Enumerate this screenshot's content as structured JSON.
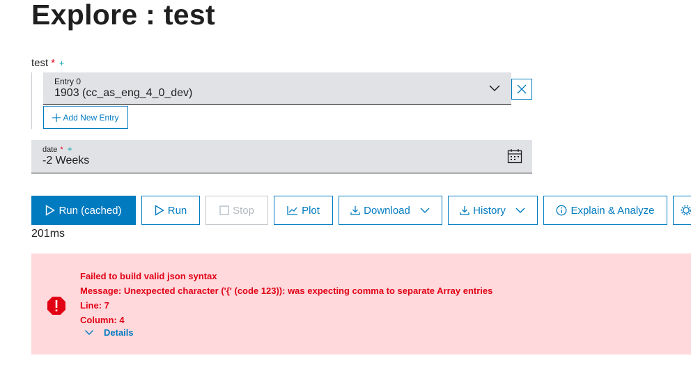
{
  "page": {
    "title": "Explore : test"
  },
  "test_field": {
    "label": "test",
    "required_mark": "*",
    "add_mark": "+",
    "entry": {
      "label": "Entry 0",
      "value": "1903 (cc_as_eng_4_0_dev)"
    },
    "add_entry_label": "Add New Entry"
  },
  "date_field": {
    "label": "date",
    "required_mark": "*",
    "add_mark": "+",
    "value": "-2 Weeks"
  },
  "toolbar": {
    "run_cached": "Run (cached)",
    "run": "Run",
    "stop": "Stop",
    "plot": "Plot",
    "download": "Download",
    "history": "History",
    "explain": "Explain & Analyze"
  },
  "timing": "201ms",
  "error": {
    "lines": [
      "Failed to build valid json syntax",
      "Message: Unexpected character ('{' (code 123)): was expecting comma to separate Array entries",
      "Line: 7",
      "Column: 4"
    ],
    "details_label": "Details"
  },
  "colors": {
    "accent": "#007bc0",
    "error": "#e20015",
    "error_bg": "#ffd9dc",
    "field_bg": "#e0e2e5"
  }
}
